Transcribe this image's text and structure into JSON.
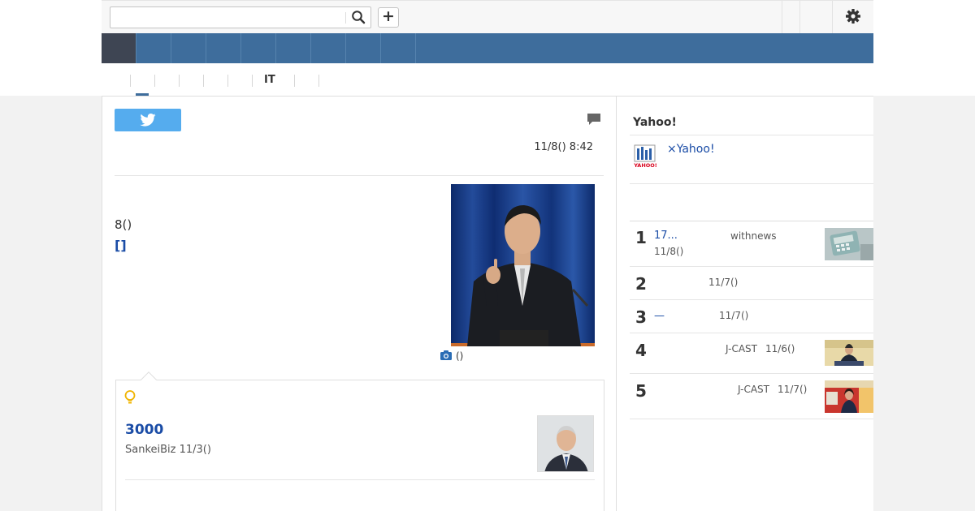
{
  "search": {
    "placeholder": "",
    "value": ""
  },
  "header": {
    "plus_label": "+"
  },
  "nav": {
    "items": [
      "",
      "",
      "",
      "",
      "",
      "",
      "",
      "",
      ""
    ]
  },
  "subtabs": {
    "it_label": "IT"
  },
  "article": {
    "date": "11/8() 8:42",
    "lead_text": "8()",
    "lead_link": "[]",
    "photo_caption": "()"
  },
  "related": {
    "title": "3000",
    "meta": "SankeiBiz 11/3()"
  },
  "sidebar": {
    "title": "Yahoo!",
    "promo": "×Yahoo!",
    "ranking": [
      {
        "rank": "1",
        "title": "17...",
        "source": "withnews",
        "date": "11/8()"
      },
      {
        "rank": "2",
        "title": "",
        "source": "",
        "date": "11/7()"
      },
      {
        "rank": "3",
        "title": "—",
        "source": "",
        "date": "11/7()"
      },
      {
        "rank": "4",
        "title": "",
        "source": "J-CAST",
        "date": "11/6()"
      },
      {
        "rank": "5",
        "title": "",
        "source": "J-CAST",
        "date": "11/7()"
      }
    ]
  },
  "colors": {
    "nav_blue": "#3e6d9c",
    "nav_active": "#3e4553",
    "link_blue": "#1a4ca6",
    "twitter": "#55acee"
  },
  "icons": [
    "search-icon",
    "plus-icon",
    "gear-icon",
    "twitter-icon",
    "comment-icon",
    "camera-icon",
    "bulb-icon",
    "yahoo-logo-icon"
  ]
}
